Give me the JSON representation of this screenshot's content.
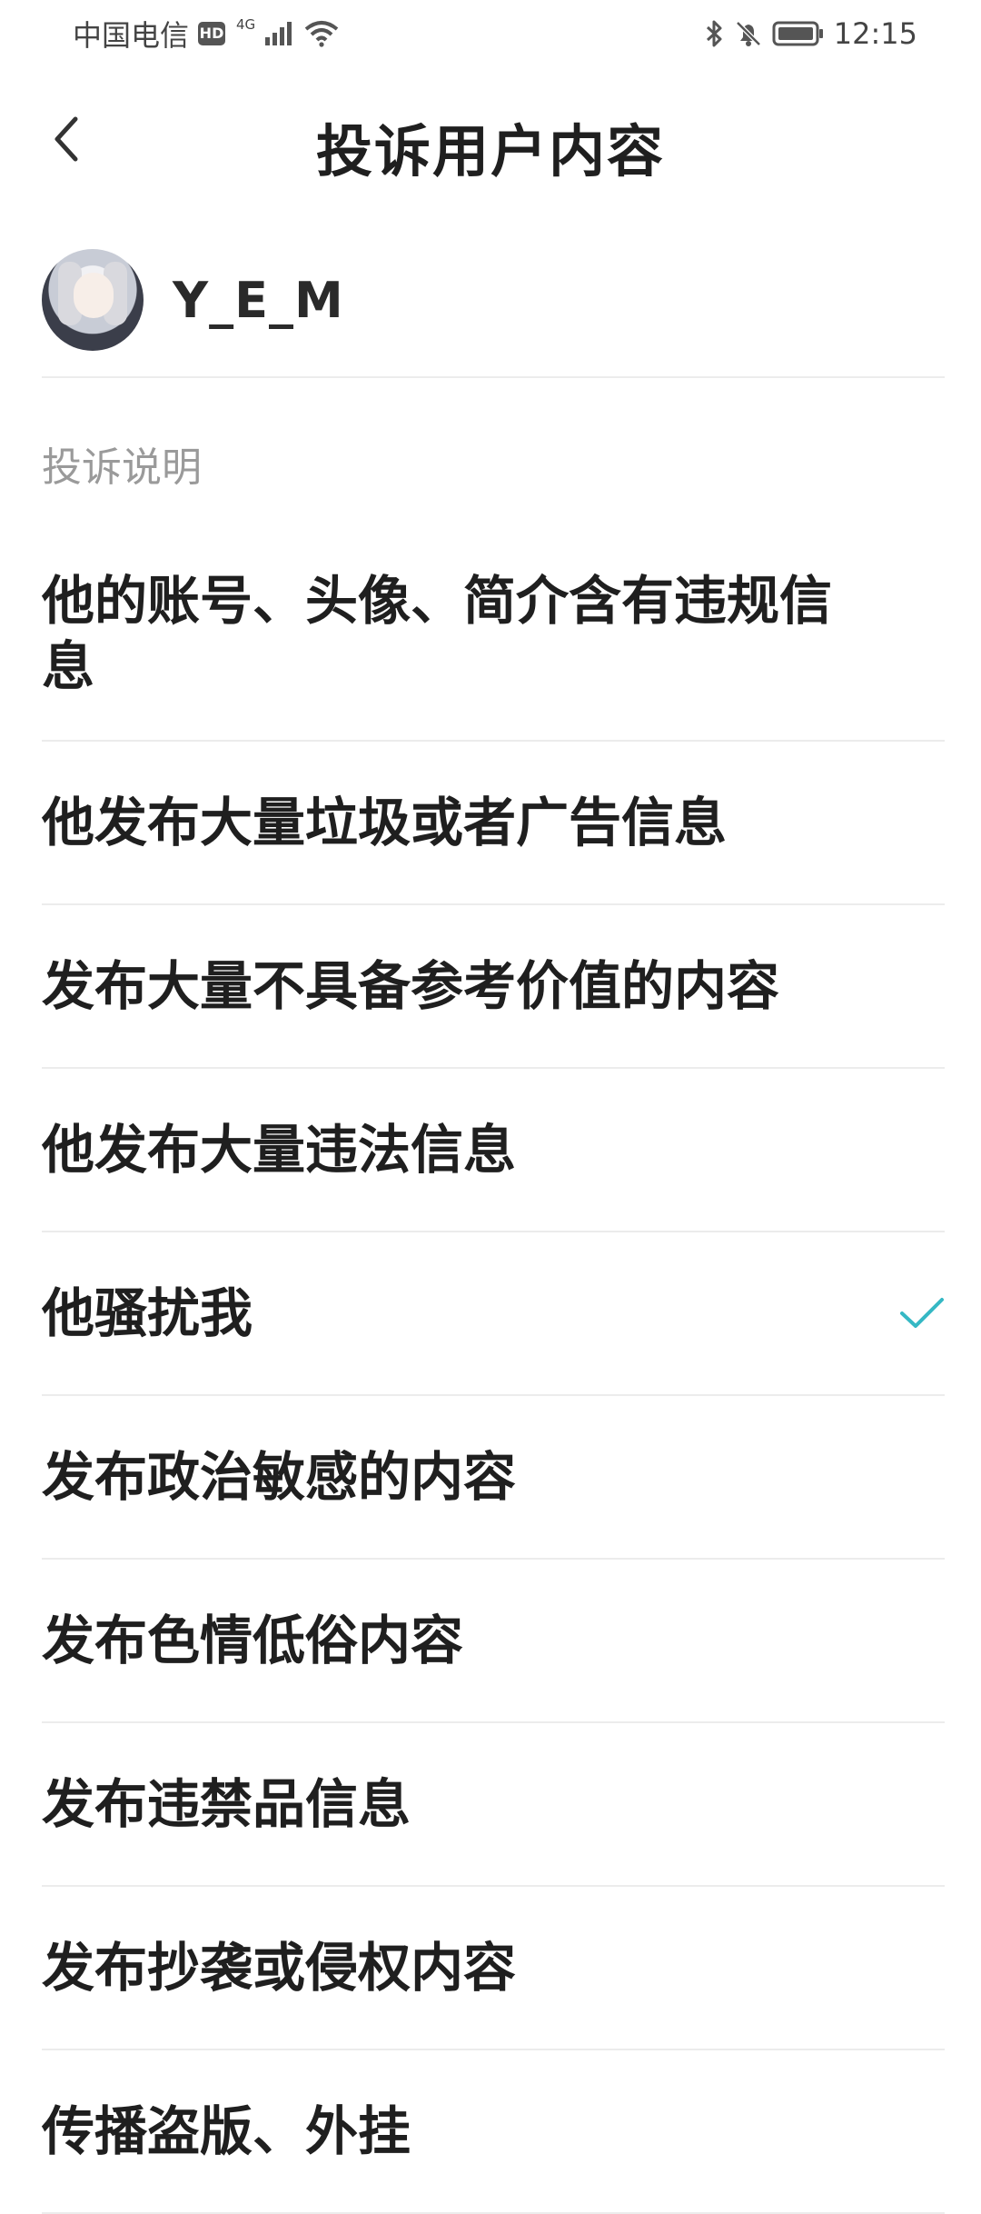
{
  "status_bar": {
    "carrier": "中国电信",
    "hd": "HD",
    "network": "4G",
    "time": "12:15"
  },
  "header": {
    "title": "投诉用户内容"
  },
  "user": {
    "name": "Y_E_M"
  },
  "section": {
    "label": "投诉说明"
  },
  "reasons": [
    {
      "label": "他的账号、头像、简介含有违规信息",
      "selected": false
    },
    {
      "label": "他发布大量垃圾或者广告信息",
      "selected": false
    },
    {
      "label": "发布大量不具备参考价值的内容",
      "selected": false
    },
    {
      "label": "他发布大量违法信息",
      "selected": false
    },
    {
      "label": "他骚扰我",
      "selected": true
    },
    {
      "label": "发布政治敏感的内容",
      "selected": false
    },
    {
      "label": "发布色情低俗内容",
      "selected": false
    },
    {
      "label": "发布违禁品信息",
      "selected": false
    },
    {
      "label": "发布抄袭或侵权内容",
      "selected": false
    },
    {
      "label": "传播盗版、外挂",
      "selected": false
    }
  ],
  "colors": {
    "accent": "#35b8c4",
    "divider": "#ececec",
    "muted_text": "#9a9a9a"
  },
  "icons": {
    "back": "chevron-left-icon",
    "check": "check-icon",
    "bluetooth": "bluetooth-icon",
    "mute": "bell-off-icon",
    "battery": "battery-icon",
    "wifi": "wifi-icon",
    "signal": "signal-icon"
  }
}
